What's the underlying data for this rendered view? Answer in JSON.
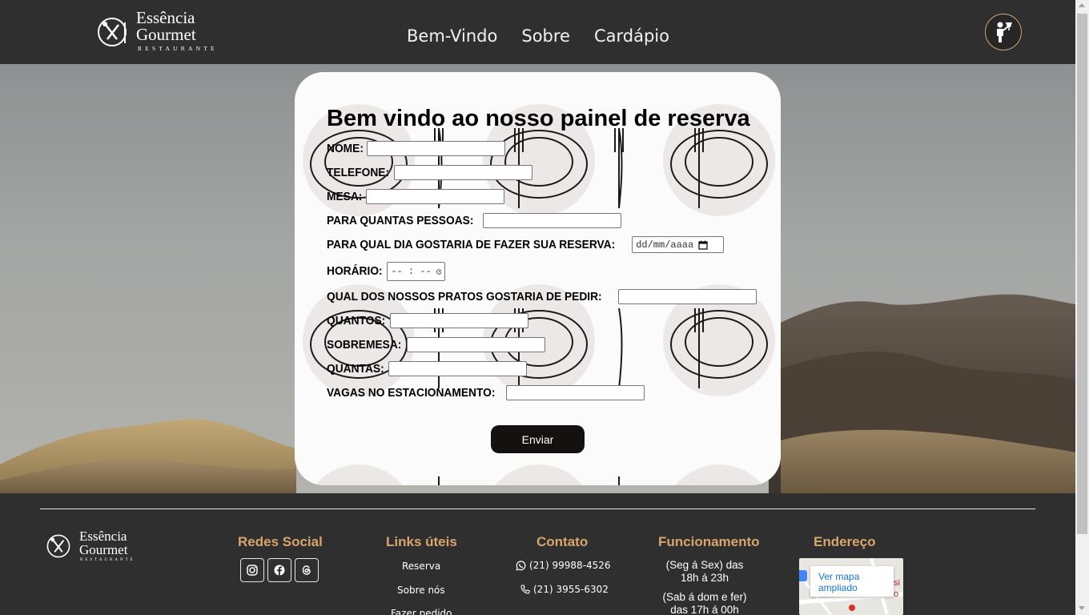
{
  "brand": {
    "title_line1": "Essência",
    "title_line2": "Gourmet",
    "subtitle": "RESTAURANTE"
  },
  "nav": {
    "items": [
      "Bem-Vindo",
      "Sobre",
      "Cardápio"
    ]
  },
  "form": {
    "title": "Bem vindo ao nosso painel de reserva",
    "fields": {
      "nome": "NOME:",
      "telefone": "TELEFONE:",
      "mesa": "MESA:",
      "pessoas": "PARA QUANTAS PESSOAS:",
      "dia": "PARA QUAL DIA GOSTARIA DE FAZER SUA RESERVA:",
      "horario": "HORÁRIO:",
      "prato": "QUAL DOS NOSSOS PRATOS GOSTARIA DE PEDIR:",
      "quantos": "QUANTOS:",
      "sobremesa": "SOBREMESA:",
      "quantas": "QUANTAS:",
      "vagas": "VAGAS NO ESTACIONAMENTO:"
    },
    "date_placeholder": "dd/mm/aaaa",
    "time_placeholder": "-- : --",
    "submit_label": "Enviar"
  },
  "footer": {
    "social": {
      "title": "Redes Social",
      "icons": [
        "instagram-icon",
        "facebook-icon",
        "threads-icon"
      ]
    },
    "links": {
      "title": "Links úteis",
      "items": [
        "Reserva",
        "Sobre nós",
        "Fazer pedido"
      ]
    },
    "contact": {
      "title": "Contato",
      "whatsapp": "(21) 99988-4526",
      "phone": "(21) 3955-6302"
    },
    "hours": {
      "title": "Funcionamento",
      "weekdays_1": "(Seg á Sex) das",
      "weekdays_2": "18h á 23h",
      "weekend_1": "(Sab á dom e fer)",
      "weekend_2": "das 17h á 00h"
    },
    "address": {
      "title": "Endereço",
      "map_link": "Ver mapa ampliado"
    }
  },
  "colors": {
    "dark": "#2f2f2f",
    "accent": "#d9a56c",
    "button": "#141110",
    "link_blue": "#1a73e8"
  }
}
